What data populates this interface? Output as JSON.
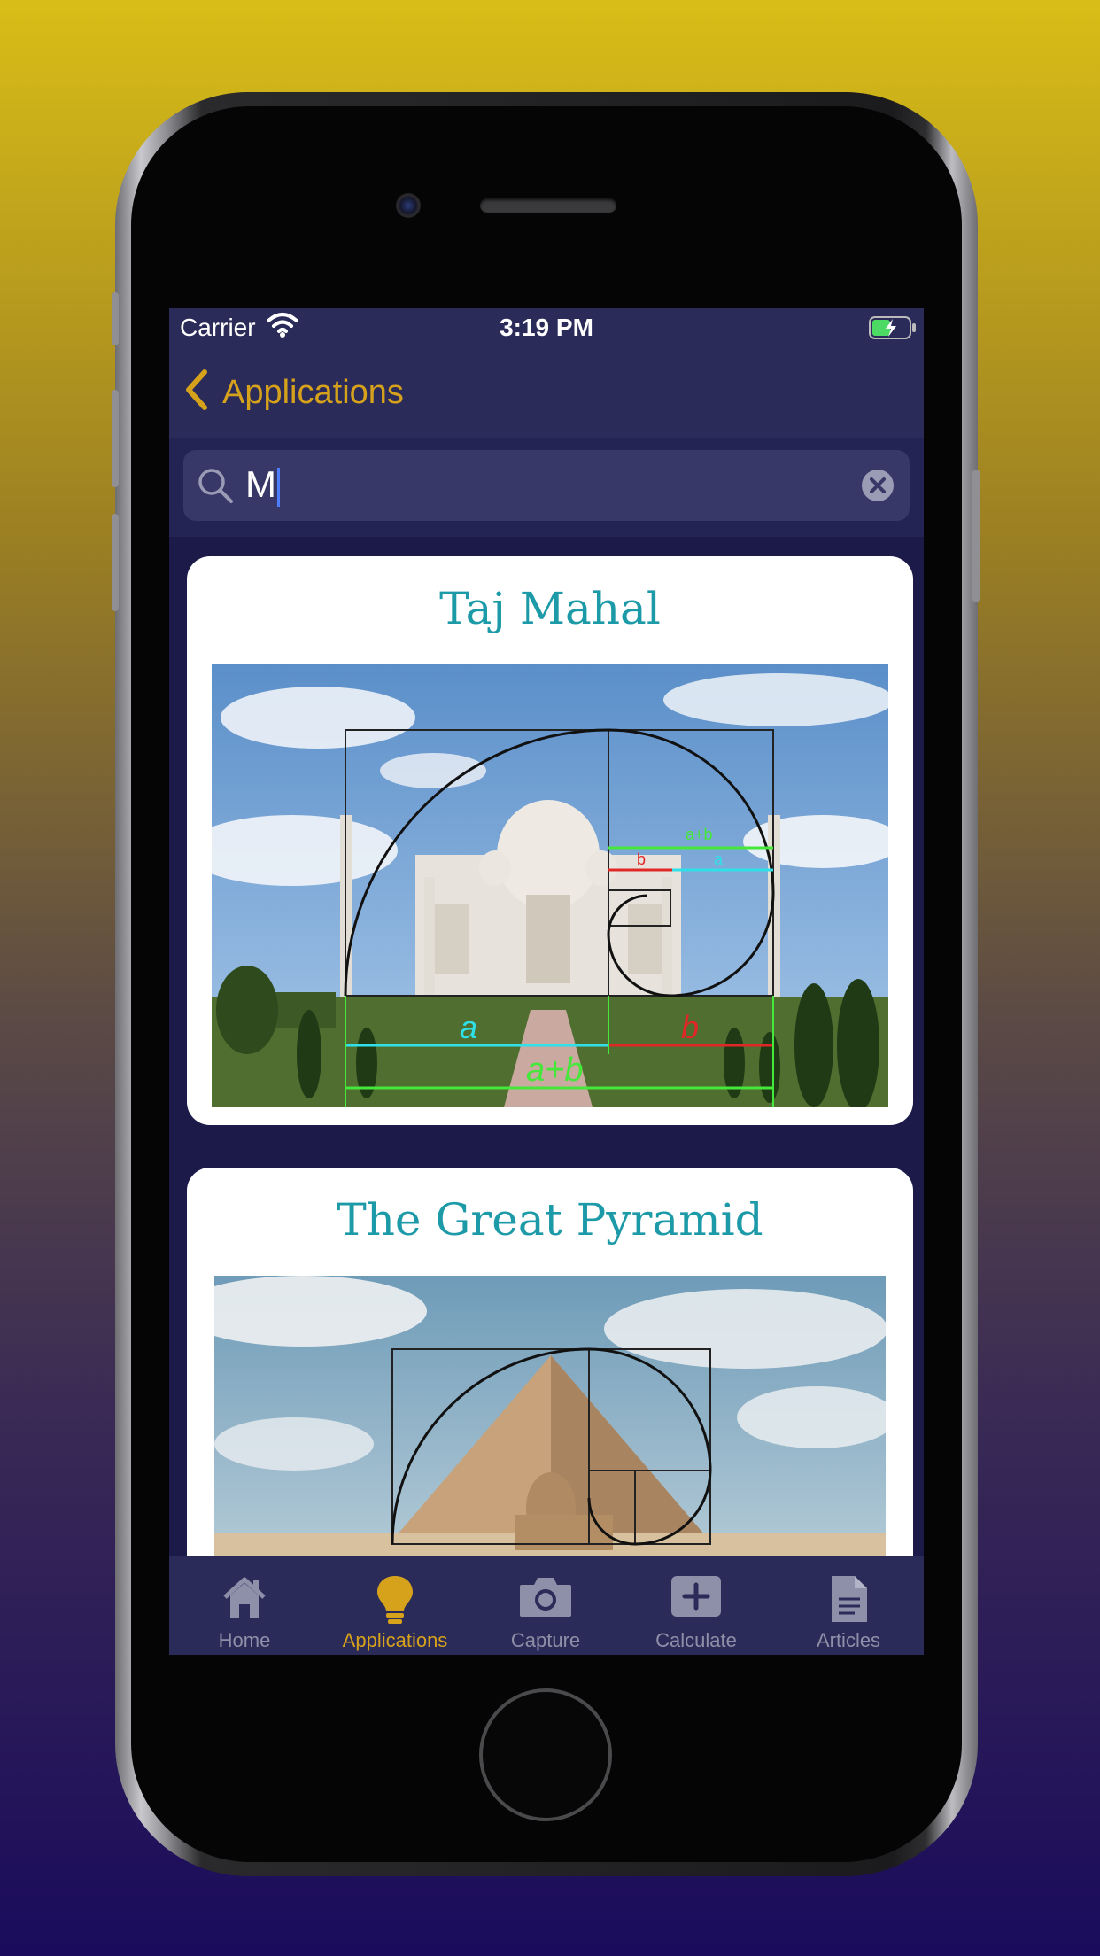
{
  "status_bar": {
    "carrier": "Carrier",
    "time": "3:19 PM"
  },
  "nav": {
    "back_label": "Applications"
  },
  "search": {
    "value": "M"
  },
  "cards": [
    {
      "title": "Taj Mahal",
      "image_labels": {
        "a": "a",
        "b": "b",
        "ab": "a+b"
      }
    },
    {
      "title": "The Great Pyramid"
    }
  ],
  "tabs": [
    {
      "label": "Home",
      "icon": "home-icon"
    },
    {
      "label": "Applications",
      "icon": "lightbulb-icon",
      "selected": true
    },
    {
      "label": "Capture",
      "icon": "camera-icon"
    },
    {
      "label": "Calculate",
      "icon": "plus-square-icon"
    },
    {
      "label": "Articles",
      "icon": "document-icon"
    }
  ],
  "colors": {
    "accent": "#d6a21c",
    "title_teal": "#1d9aa7",
    "nav_bg": "#2a2b58",
    "screen_bg": "#1c1a48"
  }
}
